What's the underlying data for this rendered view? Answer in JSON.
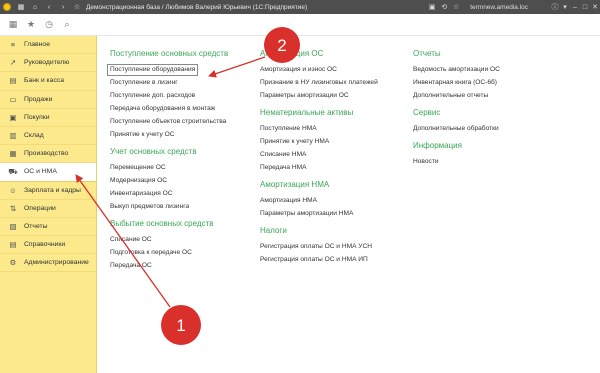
{
  "titlebar": {
    "title": "Демонстрационная база / Любимов Валерий Юрьевич  (1С:Предприятие)",
    "server": "termnew.amedia.loc",
    "icons": [
      "app-logo",
      "grid",
      "home",
      "back",
      "forward",
      "star"
    ]
  },
  "toolbar": {
    "icons": [
      "apps-grid",
      "star",
      "history",
      "search"
    ]
  },
  "sidebar": {
    "items": [
      {
        "label": "Главное",
        "icon": "list-icon"
      },
      {
        "label": "Руководителю",
        "icon": "chart-icon"
      },
      {
        "label": "Банк и касса",
        "icon": "bank-icon"
      },
      {
        "label": "Продажи",
        "icon": "sales-icon"
      },
      {
        "label": "Покупки",
        "icon": "purchases-icon"
      },
      {
        "label": "Склад",
        "icon": "warehouse-icon"
      },
      {
        "label": "Производство",
        "icon": "factory-icon"
      },
      {
        "label": "ОС и НМА",
        "icon": "truck-icon",
        "active": true
      },
      {
        "label": "Зарплата и кадры",
        "icon": "people-icon"
      },
      {
        "label": "Операции",
        "icon": "operations-icon"
      },
      {
        "label": "Отчеты",
        "icon": "reports-icon"
      },
      {
        "label": "Справочники",
        "icon": "books-icon"
      },
      {
        "label": "Администрирование",
        "icon": "settings-icon"
      }
    ]
  },
  "sections": {
    "col1": [
      {
        "title": "Поступление основных средств",
        "links": [
          "Поступление оборудования",
          "Поступление в лизинг",
          "Поступление доп. расходов",
          "Передача оборудования в монтаж",
          "Поступление объектов строительства",
          "Принятие к учету ОС"
        ]
      },
      {
        "title": "Учет основных средств",
        "links": [
          "Перемещение ОС",
          "Модернизация ОС",
          "Инвентаризация ОС",
          "Выкуп предметов лизинга"
        ]
      },
      {
        "title": "Выбытие основных средств",
        "links": [
          "Списание ОС",
          "Подготовка к передаче ОС",
          "Передача ОС"
        ]
      }
    ],
    "col2": [
      {
        "title": "Амортизация ОС",
        "links": [
          "Амортизация и износ ОС",
          "Признание в НУ лизинговых платежей",
          "Параметры амортизации ОС"
        ]
      },
      {
        "title": "Нематериальные активы",
        "links": [
          "Поступление НМА",
          "Принятие к учету НМА",
          "Списание НМА",
          "Передача НМА"
        ]
      },
      {
        "title": "Амортизация НМА",
        "links": [
          "Амортизация НМА",
          "Параметры амортизации НМА"
        ]
      },
      {
        "title": "Налоги",
        "links": [
          "Регистрация оплаты ОС и НМА УСН",
          "Регистрация оплаты ОС и НМА ИП"
        ]
      }
    ],
    "col3": [
      {
        "title": "Отчеты",
        "links": [
          "Ведомость амортизации ОС",
          "Инвентарная книга (ОС-6б)",
          "Дополнительные отчеты"
        ]
      },
      {
        "title": "Сервис",
        "links": [
          "Дополнительные обработки"
        ]
      },
      {
        "title": "Информация",
        "links": [
          "Новости"
        ]
      }
    ]
  },
  "annotations": {
    "marker1": "1",
    "marker2": "2",
    "color": "#d9302c"
  },
  "colors": {
    "sidebar": "#fbe98c",
    "section_title": "#3aa65a",
    "titlebar": "#4e4e4e"
  }
}
